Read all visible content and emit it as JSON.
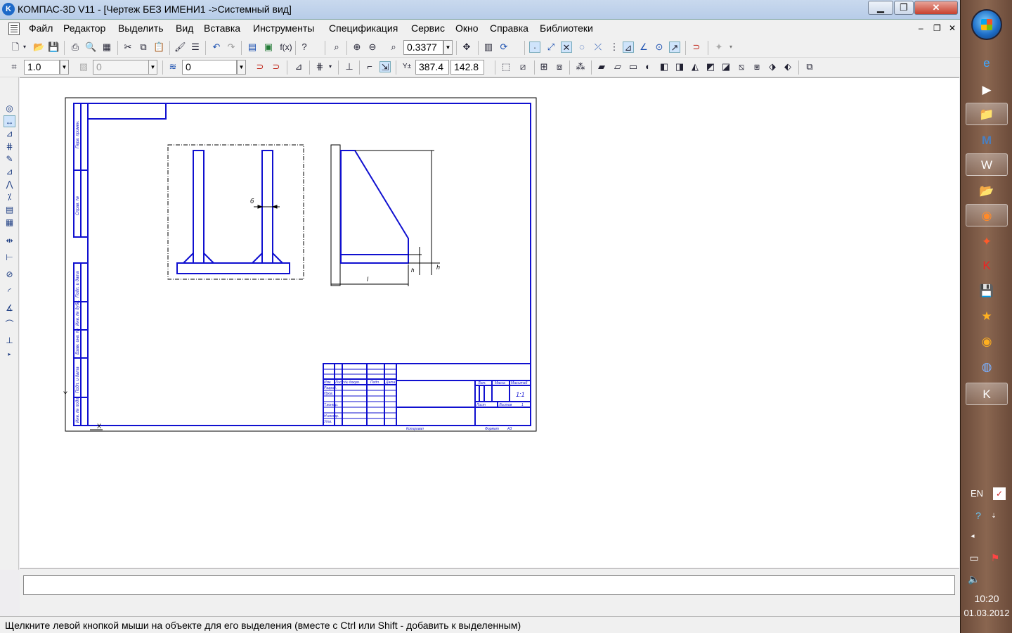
{
  "window": {
    "title": "КОМПАС-3D V11 - [Чертеж БЕЗ ИМЕНИ1 ->Системный вид]",
    "logo": "K",
    "min_label": "▁",
    "max_label": "❐",
    "close_label": "✕"
  },
  "menu": {
    "items": [
      "Файл",
      "Редактор",
      "Выделить",
      "Вид",
      "Вставка",
      "Инструменты",
      "Спецификация",
      "Сервис",
      "Окно",
      "Справка",
      "Библиотеки"
    ],
    "mdi_min": "–",
    "mdi_restore": "❐",
    "mdi_close": "✕"
  },
  "toolbar1": {
    "zoom_value": "0.3377",
    "fx_label": "f(x)"
  },
  "toolbar2": {
    "step_value": "1.0",
    "layer_value": "0",
    "style_value": "0",
    "coord_x": "387.4",
    "coord_y": "142.8",
    "cursor_label": "Y±"
  },
  "drawing": {
    "dim_b": "б",
    "dim_l": "l",
    "dim_h": "h",
    "dim_small": "h",
    "title_block": {
      "lit": "Лит.",
      "mass": "Масса",
      "scale": "Масштаб",
      "scale_value": "1:1",
      "sheet": "Лист",
      "sheets": "Листов",
      "sheets_value": "1",
      "copied": "Копировал",
      "format": "Формат",
      "format_value": "А3",
      "izm": "Изм.",
      "list": "Лист",
      "ndoc": "№ докум.",
      "podp": "Подп.",
      "data": "Дата",
      "razrab": "Разраб.",
      "prov": "Пров.",
      "tkontr": "Т.контр.",
      "nkontr": "Н.контр.",
      "utv": "Утв."
    },
    "side_labels": [
      "Перв. примен.",
      "Справ. №",
      "Подп. и дата",
      "Инв. № дубл.",
      "Взам. инв. №",
      "Подп. и дата",
      "Инв. № подл."
    ],
    "axis_y": "Y",
    "axis_x": "X"
  },
  "status": {
    "text": "Щелкните левой кнопкой мыши на объекте для его выделения (вместе с Ctrl или Shift - добавить к выделенным)"
  },
  "taskbar": {
    "apps": [
      "ie-icon",
      "media-icon",
      "folder-icon",
      "m-app-icon",
      "word-icon",
      "folder2-icon",
      "firefox-icon",
      "app-icon",
      "kaspersky-icon",
      "save-icon",
      "star-icon",
      "circle-app-icon",
      "network-icon",
      "kompas-icon"
    ],
    "lang": "EN",
    "time": "10:20",
    "date": "01.03.2012"
  }
}
